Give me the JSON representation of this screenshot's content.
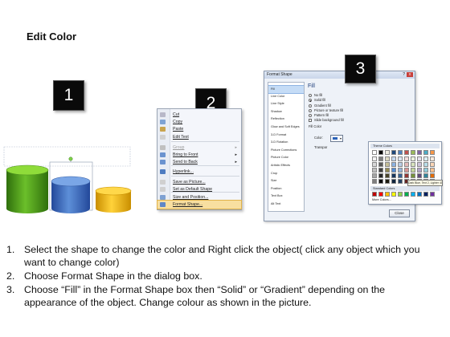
{
  "slide": {
    "title": "Edit Color",
    "badges": [
      "1",
      "2",
      "3"
    ]
  },
  "context_menu": {
    "items": [
      {
        "label": "Cut",
        "icon": "scissors-icon",
        "color": "#b8b8c8"
      },
      {
        "label": "Copy",
        "icon": "copy-icon",
        "color": "#7fa3d4"
      },
      {
        "label": "Paste",
        "icon": "paste-icon",
        "color": "#c9a44d"
      },
      {
        "label": "Edit Text",
        "icon": "text-icon",
        "color": "#d0d0d0"
      },
      {
        "label": "Group",
        "icon": "group-icon",
        "color": "#c0c0c0",
        "disabled": true,
        "submenu": true
      },
      {
        "label": "Bring to Front",
        "icon": "bring-front-icon",
        "color": "#6b93cf",
        "submenu": true
      },
      {
        "label": "Send to Back",
        "icon": "send-back-icon",
        "color": "#6b93cf",
        "submenu": true
      },
      {
        "label": "Hyperlink...",
        "icon": "hyperlink-icon",
        "color": "#4e7cc1"
      },
      {
        "label": "Save as Picture...",
        "icon": "picture-icon",
        "color": "#d0d0d0"
      },
      {
        "label": "Set as Default Shape",
        "icon": "default-shape-icon",
        "color": "#d0d0d0"
      },
      {
        "label": "Size and Position...",
        "icon": "size-icon",
        "color": "#7ea1d2"
      },
      {
        "label": "Format Shape...",
        "icon": "format-shape-icon",
        "color": "#5f87c7",
        "highlighted": true
      }
    ]
  },
  "dialog": {
    "title": "Format Shape",
    "help": "?",
    "close_x": "X",
    "nav": [
      "Fill",
      "Line Color",
      "Line Style",
      "Shadow",
      "Reflection",
      "Glow and Soft Edges",
      "3-D Format",
      "3-D Rotation",
      "Picture Corrections",
      "Picture Color",
      "Artistic Effects",
      "Crop",
      "Size",
      "Position",
      "Text Box",
      "Alt Text"
    ],
    "selected_nav": "Fill",
    "fill": {
      "heading": "Fill",
      "options": [
        {
          "label": "No fill",
          "selected": false
        },
        {
          "label": "Solid fill",
          "selected": true
        },
        {
          "label": "Gradient fill",
          "selected": false
        },
        {
          "label": "Picture or texture fill",
          "selected": false
        },
        {
          "label": "Pattern fill",
          "selected": false
        }
      ],
      "checkbox_label": "Slide background fill",
      "section_label": "Fill Color",
      "color_label": "Color:",
      "transparency_label": "Transpar"
    },
    "palette": {
      "theme_heading": "Theme Colors",
      "standard_heading": "Standard Colors",
      "more": "More Colors...",
      "tooltip": "Dark Blue, Text 2, Lighter 40%",
      "theme_top": [
        "#ffffff",
        "#000000",
        "#eeece1",
        "#1f497d",
        "#4f81bd",
        "#c0504d",
        "#9bbb59",
        "#8064a2",
        "#4bacc6",
        "#f79646"
      ],
      "theme_shades": [
        [
          "#f2f2f2",
          "#7f7f7f",
          "#ddd9c3",
          "#c6d9f0",
          "#dbe5f1",
          "#f2dcdb",
          "#ebf1dd",
          "#e5e0ec",
          "#dbeef3",
          "#fdeada"
        ],
        [
          "#d8d8d8",
          "#595959",
          "#c4bd97",
          "#8db3e2",
          "#b8cce4",
          "#e5b9b7",
          "#d7e3bc",
          "#ccc1d9",
          "#b7dde8",
          "#fbd5b5"
        ],
        [
          "#bfbfbf",
          "#3f3f3f",
          "#938953",
          "#548dd4",
          "#95b3d7",
          "#d99694",
          "#c3d69b",
          "#b2a2c7",
          "#92cddc",
          "#fac08f"
        ],
        [
          "#a5a5a5",
          "#262626",
          "#494429",
          "#17365d",
          "#366092",
          "#953734",
          "#76923c",
          "#5f497a",
          "#31859b",
          "#e36c09"
        ],
        [
          "#7f7f7f",
          "#0c0c0c",
          "#1d1b10",
          "#0f243e",
          "#244061",
          "#632423",
          "#4f6128",
          "#3f3151",
          "#205867",
          "#974806"
        ]
      ],
      "standard": [
        "#c00000",
        "#ff0000",
        "#ffc000",
        "#ffff00",
        "#92d050",
        "#00b050",
        "#00b0f0",
        "#0070c0",
        "#002060",
        "#7030a0"
      ]
    },
    "close_label": "Close"
  },
  "cylinders": [
    {
      "name": "green",
      "color": "#4d9a1d"
    },
    {
      "name": "blue",
      "color": "#3f6fc0"
    },
    {
      "name": "yellow",
      "color": "#f0b400"
    }
  ],
  "instructions": [
    {
      "num": "1.",
      "lines": [
        "Select the shape to change the color and Right click the object( click any object which you",
        "want to change color)"
      ]
    },
    {
      "num": "2.",
      "lines": [
        "Choose Format Shape in the dialog box."
      ]
    },
    {
      "num": "3.",
      "lines": [
        "Choose “Fill” in the Format Shape box then “Solid” or “Gradient” depending on the",
        "appearance of the object. Change colour as shown in the picture."
      ]
    }
  ]
}
